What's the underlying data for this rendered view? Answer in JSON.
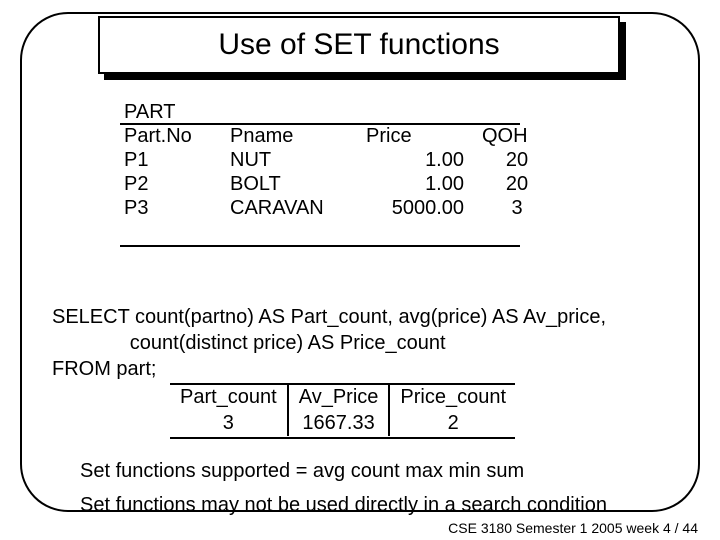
{
  "title": "Use of SET functions",
  "part_table": {
    "caption": "PART",
    "headers": {
      "partno": "Part.No",
      "pname": "Pname",
      "price": "Price",
      "qoh": "QOH"
    },
    "rows": [
      {
        "partno": "P1",
        "pname": "NUT",
        "price": "1.00",
        "qoh": "20"
      },
      {
        "partno": "P2",
        "pname": "BOLT",
        "price": "1.00",
        "qoh": "20"
      },
      {
        "partno": "P3",
        "pname": "CARAVAN",
        "price": "5000.00",
        "qoh": "3"
      }
    ]
  },
  "sql": {
    "line1": "SELECT count(partno) AS Part_count, avg(price) AS Av_price,",
    "line2": "              count(distinct price) AS Price_count",
    "line3": "FROM part;"
  },
  "result_table": {
    "headers": {
      "part_count": "Part_count",
      "av_price": "Av_Price",
      "price_count": "Price_count"
    },
    "row": {
      "part_count": "3",
      "av_price": "1667.33",
      "price_count": "2"
    }
  },
  "notes": {
    "n1": "Set functions supported  = avg  count  max  min  sum",
    "n2": "Set functions may not be used directly in a search condition"
  },
  "footer": "CSE 3180 Semester 1 2005  week 4 / 44",
  "chart_data": [
    {
      "type": "table",
      "title": "PART",
      "columns": [
        "Part.No",
        "Pname",
        "Price",
        "QOH"
      ],
      "rows": [
        [
          "P1",
          "NUT",
          1.0,
          20
        ],
        [
          "P2",
          "BOLT",
          1.0,
          20
        ],
        [
          "P3",
          "CARAVAN",
          5000.0,
          3
        ]
      ]
    },
    {
      "type": "table",
      "title": "Query result",
      "columns": [
        "Part_count",
        "Av_Price",
        "Price_count"
      ],
      "rows": [
        [
          3,
          1667.33,
          2
        ]
      ]
    }
  ]
}
